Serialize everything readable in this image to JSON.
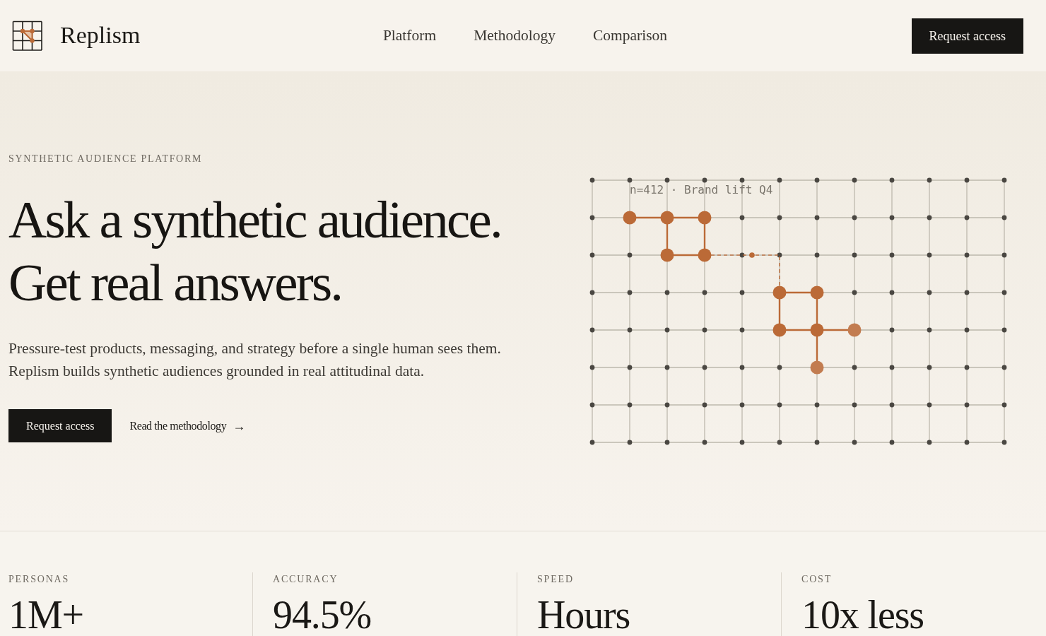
{
  "header": {
    "brand": "Replism",
    "nav": [
      {
        "label": "Platform"
      },
      {
        "label": "Methodology"
      },
      {
        "label": "Comparison"
      }
    ],
    "cta": "Request access"
  },
  "hero": {
    "eyebrow": "SYNTHETIC AUDIENCE PLATFORM",
    "headline_lines": [
      "Ask a synthetic audience.",
      "Get real answers."
    ],
    "description": "Pressure-test products, messaging, and strategy before a single human sees them. Replism builds synthetic audiences grounded in real attitudinal data.",
    "primary_button": "Request access",
    "secondary_link": {
      "label": "Read the methodology",
      "arrow": "→"
    },
    "diagram": {
      "caption": "n=412 · Brand lift Q4"
    }
  },
  "stats": [
    {
      "label": "PERSONAS",
      "value": "1M+"
    },
    {
      "label": "ACCURACY",
      "value": "94.5%"
    },
    {
      "label": "SPEED",
      "value": "Hours"
    },
    {
      "label": "COST",
      "value": "10x less"
    }
  ]
}
